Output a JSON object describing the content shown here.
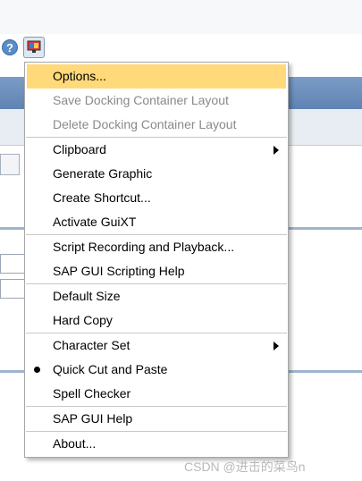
{
  "toolbar": {
    "help_icon": "help-icon",
    "help_glyph": "?",
    "layout_icon": "customize-layout-icon"
  },
  "menu": {
    "items": [
      {
        "label": "Options...",
        "highlighted": true
      },
      {
        "label": "Save Docking Container Layout",
        "disabled": true
      },
      {
        "label": "Delete Docking Container Layout",
        "disabled": true
      },
      {
        "label": "Clipboard",
        "submenu": true
      },
      {
        "label": "Generate Graphic"
      },
      {
        "label": "Create Shortcut..."
      },
      {
        "label": "Activate GuiXT"
      },
      {
        "label": "Script Recording and Playback..."
      },
      {
        "label": "SAP GUI Scripting Help"
      },
      {
        "label": "Default Size"
      },
      {
        "label": "Hard Copy"
      },
      {
        "label": "Character Set",
        "submenu": true
      },
      {
        "label": "Quick Cut and Paste",
        "checked": true
      },
      {
        "label": "Spell Checker"
      },
      {
        "label": "SAP GUI Help"
      },
      {
        "label": "About..."
      }
    ]
  },
  "colors": {
    "highlight": "#ffd97a",
    "disabled_text": "#8a8a8a",
    "header_band": "#6b8fbf"
  },
  "watermark": "CSDN @进击的菜鸟n"
}
